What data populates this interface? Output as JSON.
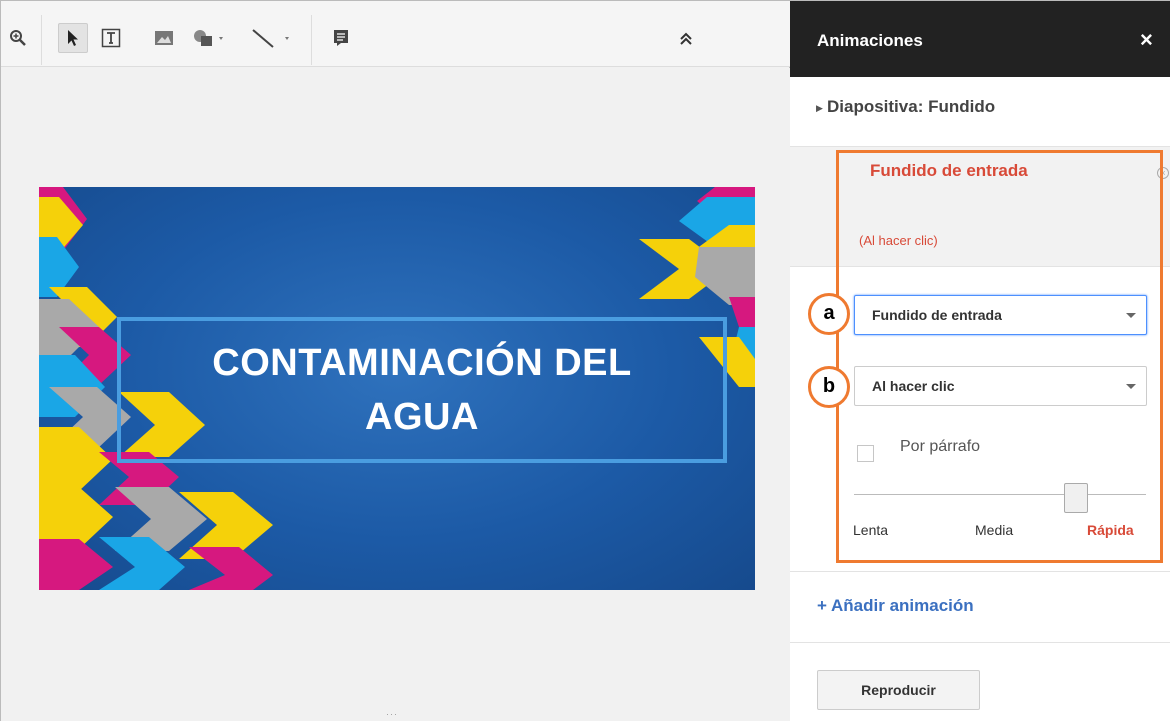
{
  "toolbar": {
    "tools": [
      "zoom-icon",
      "cursor-icon",
      "textbox-icon",
      "image-icon",
      "shape-icon",
      "line-icon",
      "comment-icon"
    ],
    "collapse_icon": "double-chevron-up-icon"
  },
  "slide": {
    "title": "CONTAMINACIÓN DEL\nAGUA",
    "colors": {
      "bg": "#1c5aa6",
      "magenta": "#d6187f",
      "yellow": "#f5d10a",
      "cyan": "#1aa6e6",
      "gray": "#a9a9a9"
    }
  },
  "panel": {
    "title": "Animaciones",
    "close": "×",
    "slide_transition": "Diapositiva: Fundido",
    "animation": {
      "name": "Fundido de entrada",
      "trigger": "(Al hacer clic)"
    },
    "effect_select": "Fundido de entrada",
    "trigger_select": "Al hacer clic",
    "by_paragraph": "Por párrafo",
    "speed": {
      "slow": "Lenta",
      "medium": "Media",
      "fast": "Rápida",
      "value": 0.76
    },
    "add_animation": "+ Añadir animación",
    "play": "Reproducir"
  },
  "annotations": {
    "a": "a",
    "b": "b"
  },
  "accent": {
    "orange": "#ef7a30",
    "red": "#d84a38",
    "blue": "#3b70c0"
  }
}
